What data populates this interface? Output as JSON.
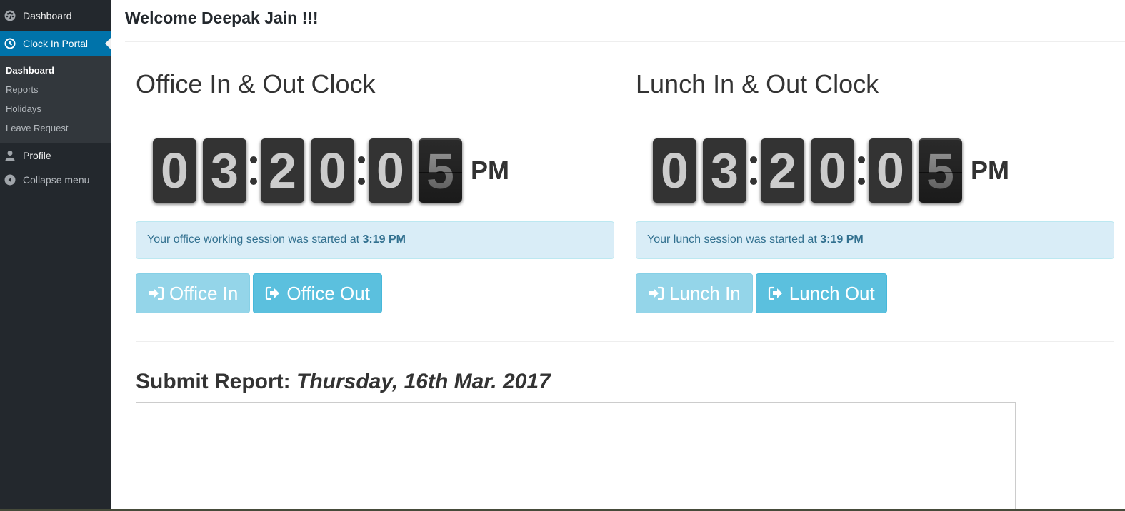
{
  "sidebar": {
    "dashboard": {
      "label": "Dashboard",
      "icon": "dashboard-gauge-icon"
    },
    "clock_in_portal": {
      "label": "Clock In Portal",
      "icon": "clock-icon"
    },
    "submenu": [
      {
        "label": "Dashboard",
        "current": true
      },
      {
        "label": "Reports",
        "current": false
      },
      {
        "label": "Holidays",
        "current": false
      },
      {
        "label": "Leave Request",
        "current": false
      }
    ],
    "profile": {
      "label": "Profile",
      "icon": "user-icon"
    },
    "collapse": {
      "label": "Collapse menu",
      "icon": "collapse-arrow-icon"
    }
  },
  "main": {
    "welcome": "Welcome Deepak Jain !!!",
    "office": {
      "title": "Office In & Out Clock",
      "digits": [
        "0",
        "3",
        "2",
        "0",
        "0",
        "5"
      ],
      "ampm": "PM",
      "alert_text": "Your office working session was started at ",
      "alert_time": "3:19 PM",
      "in_label": "Office In",
      "out_label": "Office Out"
    },
    "lunch": {
      "title": "Lunch In & Out Clock",
      "digits": [
        "0",
        "3",
        "2",
        "0",
        "0",
        "5"
      ],
      "ampm": "PM",
      "alert_text": "Your lunch session was started at ",
      "alert_time": "3:19 PM",
      "in_label": "Lunch In",
      "out_label": "Lunch Out"
    },
    "report": {
      "label": "Submit Report: ",
      "date": "Thursday, 16th Mar. 2017",
      "value": ""
    }
  },
  "colors": {
    "sidebar_bg": "#23282d",
    "active_menu": "#0073aa",
    "info_button": "#5bc0de",
    "alert_bg": "#d9edf7",
    "alert_text": "#31708f"
  }
}
